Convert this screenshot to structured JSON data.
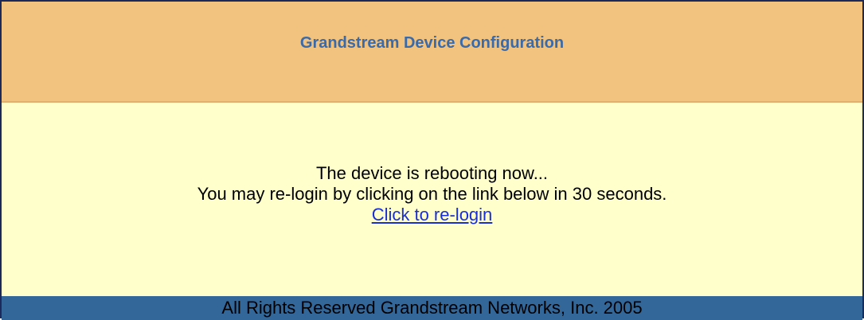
{
  "header": {
    "title": "Grandstream Device Configuration"
  },
  "main": {
    "line1": "The device is rebooting now...",
    "line2": "You may re-login by clicking on the link below in 30 seconds.",
    "relogin_link": "Click to re-login"
  },
  "footer": {
    "copyright": "All Rights Reserved Grandstream Networks, Inc. 2005"
  },
  "colors": {
    "header_bg": "#f2c27f",
    "title_color": "#3b6aa8",
    "content_bg": "#ffffcc",
    "footer_bg": "#336699",
    "link_color": "#1a2ed6"
  }
}
